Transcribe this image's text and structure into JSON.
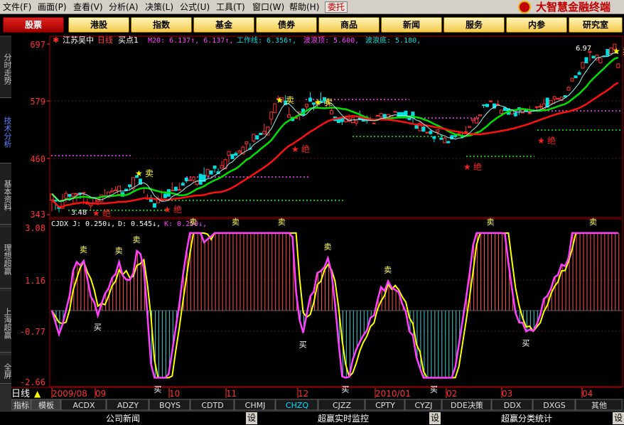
{
  "menu": [
    "文件(F)",
    "画面(P)",
    "查看(V)",
    "分析(A)",
    "决策(L)",
    "公式(U)",
    "工具(T)",
    "窗口(W)",
    "帮助(H)"
  ],
  "weituo": "委托",
  "brand": "大智慧金融终端",
  "nav": [
    "股票",
    "港股",
    "指数",
    "基金",
    "债券",
    "商品",
    "新闻",
    "服务",
    "内参",
    "研究室"
  ],
  "side_tabs": [
    "分时走势",
    "技术分析",
    "基本资料",
    "理想超赢",
    "上海超赢",
    "全屏"
  ],
  "main": {
    "name": "江苏吴中",
    "period": "日线",
    "point": "买点1",
    "ma": "M20: 6.137↑, 6.137↑,",
    "work_label": "工作线: 6.356↑,",
    "wave_top": "波浪顶: 5.600,",
    "wave_bottom": "波浪底: 5.180,",
    "y_ticks": [
      "697",
      "579",
      "460",
      "343"
    ],
    "low_label": "3.48",
    "high_label": "6.97",
    "sell": "卖",
    "jue": "绝"
  },
  "indicator": {
    "name": "CJDX",
    "j": "J: 0.250↓,",
    "d": "D: 0.545↓,",
    "k": "K: 0.250↓,",
    "y_ticks": [
      "3.08",
      "1.16",
      "-0.77",
      "-2.66"
    ],
    "buy": "买",
    "sell": "卖"
  },
  "timeaxis": {
    "label": "日线",
    "ticks": [
      "2009/08",
      "09",
      "10",
      "11",
      "12",
      "2010/01",
      "02",
      "03",
      "04"
    ]
  },
  "tabs": [
    "指标",
    "模板",
    "ACDX",
    "ADZY",
    "BQYS",
    "CDTD",
    "CHMJ",
    "CHZQ",
    "CJZZ",
    "CPTY",
    "CYZJ",
    "DDE决策",
    "DDX",
    "DXGS",
    "其他"
  ],
  "active_tab": "CHZQ",
  "panels": [
    {
      "label": "公司新闻",
      "set": "设"
    },
    {
      "label": "超赢实时监控",
      "set": "设"
    },
    {
      "label": "超赢分类统计",
      "set": "设"
    }
  ],
  "colors": {
    "up": "#ff3030",
    "down": "#00e0e0",
    "green": "#00e000",
    "yellow": "#ffff00",
    "magenta": "#ff40ff",
    "red": "#ff1010",
    "brand": "#c00000"
  },
  "chart_data": {
    "candles": [
      [
        3.73,
        3.86,
        3.5,
        3.79
      ],
      [
        3.73,
        3.71,
        3.53,
        3.49
      ],
      [
        3.6,
        3.56,
        3.48,
        3.41
      ],
      [
        3.56,
        3.73,
        3.65,
        3.86
      ],
      [
        3.77,
        3.87,
        3.68,
        3.92
      ],
      [
        3.85,
        3.81,
        3.72,
        3.7
      ],
      [
        3.81,
        3.87,
        3.67,
        3.75
      ],
      [
        3.87,
        3.87,
        3.7,
        3.82
      ],
      [
        3.88,
        3.86,
        3.76,
        3.74
      ],
      [
        3.88,
        3.89,
        3.64,
        3.73
      ],
      [
        3.65,
        3.69,
        3.69,
        3.76
      ],
      [
        3.61,
        3.66,
        3.51,
        3.57
      ],
      [
        3.66,
        3.78,
        3.79,
        3.71
      ],
      [
        3.7,
        3.73,
        3.62,
        3.62
      ],
      [
        3.71,
        3.84,
        3.86,
        3.82
      ],
      [
        3.8,
        3.82,
        3.84,
        3.96
      ],
      [
        3.79,
        3.9,
        3.98,
        3.87
      ],
      [
        3.9,
        3.92,
        4.01,
        3.99
      ],
      [
        3.94,
        3.94,
        4.02,
        4.02
      ],
      [
        3.85,
        4.02,
        3.81,
        3.94
      ],
      [
        3.89,
        3.81,
        3.92,
        3.88
      ],
      [
        3.96,
        3.93,
        4.0,
        3.95
      ],
      [
        4.05,
        4.01,
        3.95,
        3.91
      ],
      [
        3.97,
        4.2,
        3.88,
        4.06
      ],
      [
        4.24,
        4.2,
        4.21,
        4.06
      ],
      [
        4.17,
        4.06,
        4.22,
        4.11
      ],
      [
        3.99,
        3.99,
        3.87,
        3.9
      ],
      [
        3.75,
        3.77,
        3.75,
        3.86
      ],
      [
        3.78,
        3.7,
        3.71,
        3.84
      ],
      [
        3.66,
        3.58,
        3.63,
        3.56
      ],
      [
        3.67,
        3.75,
        3.78,
        3.82
      ],
      [
        3.72,
        3.74,
        3.83,
        3.94
      ],
      [
        3.86,
        3.78,
        3.86,
        3.8
      ],
      [
        3.95,
        3.81,
        3.88,
        3.83
      ],
      [
        3.92,
        3.94,
        3.96,
        4.1
      ],
      [
        4.0,
        3.93,
        3.92,
        4.01
      ],
      [
        3.94,
        3.95,
        4.01,
        4.09
      ],
      [
        4.08,
        4.04,
        4.09,
        4.11
      ],
      [
        4.19,
        4.13,
        4.09,
        4.01
      ],
      [
        4.14,
        4.15,
        4.14,
        4.21
      ],
      [
        4.14,
        4.21,
        4.11,
        4.09
      ],
      [
        4.06,
        4.12,
        4.02,
        4.11
      ],
      [
        4.27,
        4.06,
        4.32,
        4.24
      ],
      [
        4.25,
        4.12,
        4.27,
        4.41
      ],
      [
        4.23,
        4.37,
        4.29,
        4.26
      ],
      [
        4.34,
        4.27,
        4.27,
        4.29
      ],
      [
        4.44,
        4.39,
        4.3,
        4.32
      ],
      [
        4.32,
        4.28,
        4.43,
        4.39
      ],
      [
        4.39,
        4.45,
        4.49,
        4.55
      ],
      [
        4.38,
        4.57,
        4.53,
        4.59
      ],
      [
        4.66,
        4.74,
        4.51,
        4.6
      ],
      [
        4.68,
        4.59,
        4.66,
        4.58
      ],
      [
        4.7,
        4.66,
        4.69,
        4.74
      ],
      [
        4.71,
        4.75,
        4.71,
        4.78
      ],
      [
        4.69,
        4.83,
        4.85,
        4.86
      ],
      [
        4.9,
        4.94,
        4.76,
        4.73
      ],
      [
        4.8,
        4.79,
        4.81,
        4.91
      ],
      [
        4.96,
        5.1,
        4.93,
        4.91
      ],
      [
        5.07,
        5.0,
        4.98,
        5.0
      ],
      [
        5.12,
        5.09,
        5.12,
        5.08
      ],
      [
        5.1,
        5.16,
        5.27,
        5.32
      ],
      [
        5.08,
        5.25,
        5.23,
        5.16
      ],
      [
        5.41,
        5.56,
        5.29,
        5.25
      ],
      [
        5.55,
        5.73,
        5.64,
        5.58
      ],
      [
        5.84,
        5.84,
        5.94,
        5.9
      ],
      [
        5.79,
        5.86,
        5.75,
        5.65
      ],
      [
        5.79,
        5.71,
        5.88,
        5.91
      ],
      [
        5.45,
        5.5,
        5.51,
        5.66
      ],
      [
        5.45,
        5.38,
        5.37,
        5.31
      ],
      [
        5.43,
        5.44,
        5.47,
        5.5
      ],
      [
        5.49,
        5.56,
        5.39,
        5.46
      ],
      [
        5.62,
        5.5,
        5.54,
        5.64
      ],
      [
        5.67,
        5.72,
        5.58,
        5.52
      ],
      [
        5.85,
        5.78,
        5.9,
        5.97
      ],
      [
        5.75,
        5.72,
        5.59,
        5.7
      ],
      [
        5.74,
        5.78,
        5.64,
        5.6
      ],
      [
        5.79,
        5.76,
        5.88,
        5.97
      ],
      [
        5.86,
        5.79,
        5.72,
        5.79
      ],
      [
        5.65,
        5.78,
        5.67,
        5.6
      ],
      [
        5.52,
        5.59,
        5.56,
        5.66
      ],
      [
        5.46,
        5.38,
        5.39,
        5.3
      ],
      [
        5.44,
        5.34,
        5.35,
        5.44
      ],
      [
        5.44,
        5.36,
        5.29,
        5.25
      ],
      [
        5.36,
        5.43,
        5.34,
        5.48
      ],
      [
        5.37,
        5.41,
        5.35,
        5.51
      ],
      [
        5.34,
        5.44,
        5.48,
        5.44
      ],
      [
        5.33,
        5.38,
        5.27,
        5.29
      ],
      [
        5.46,
        5.4,
        5.52,
        5.59
      ],
      [
        5.45,
        5.37,
        5.42,
        5.41
      ],
      [
        5.45,
        5.38,
        5.32,
        5.49
      ],
      [
        5.38,
        5.41,
        5.41,
        5.47
      ],
      [
        5.33,
        5.33,
        5.36,
        5.31
      ],
      [
        5.49,
        5.49,
        5.52,
        5.43
      ],
      [
        5.46,
        5.53,
        5.43,
        5.49
      ],
      [
        5.51,
        5.41,
        5.47,
        5.53
      ],
      [
        5.45,
        5.51,
        5.43,
        5.45
      ],
      [
        5.46,
        5.49,
        5.43,
        5.45
      ],
      [
        5.56,
        5.57,
        5.56,
        5.51
      ],
      [
        5.55,
        5.45,
        5.52,
        5.43
      ],
      [
        5.55,
        5.44,
        5.45,
        5.4
      ],
      [
        5.58,
        5.46,
        5.41,
        5.33
      ],
      [
        5.48,
        5.4,
        5.41,
        5.35
      ],
      [
        5.56,
        5.44,
        5.3,
        5.4
      ],
      [
        5.28,
        5.22,
        5.34,
        5.14
      ],
      [
        5.17,
        5.33,
        5.31,
        5.37
      ],
      [
        5.25,
        5.16,
        5.29,
        5.29
      ],
      [
        5.14,
        5.14,
        5.11,
        5.07
      ],
      [
        5.16,
        5.11,
        5.09,
        5.21
      ],
      [
        5.05,
        5.01,
        4.93,
        4.89
      ],
      [
        5.14,
        5.19,
        5.08,
        5.17
      ],
      [
        5.02,
        4.99,
        5.04,
        5.09
      ],
      [
        4.92,
        5.02,
        5.02,
        5.05
      ],
      [
        4.95,
        4.92,
        4.91,
        4.94
      ],
      [
        5.07,
        5.0,
        4.99,
        5.09
      ],
      [
        5.07,
        5.05,
        5.02,
        5.03
      ],
      [
        5.09,
        5.11,
        5.05,
        5.14
      ],
      [
        5.06,
        5.04,
        5.06,
        5.16
      ],
      [
        5.15,
        5.15,
        5.19,
        5.27
      ],
      [
        5.24,
        5.26,
        5.29,
        5.26
      ],
      [
        5.38,
        5.41,
        5.32,
        5.25
      ],
      [
        5.33,
        5.42,
        5.46,
        5.48
      ],
      [
        5.48,
        5.5,
        5.47,
        5.36
      ],
      [
        5.71,
        5.7,
        5.64,
        5.67
      ],
      [
        5.72,
        5.67,
        5.8,
        5.7
      ],
      [
        5.79,
        5.79,
        5.76,
        5.68
      ],
      [
        5.73,
        5.64,
        5.69,
        5.65
      ],
      [
        5.71,
        5.72,
        5.78,
        5.8
      ],
      [
        5.53,
        5.6,
        5.5,
        5.57
      ],
      [
        5.65,
        5.59,
        5.61,
        5.49
      ],
      [
        5.63,
        5.51,
        5.56,
        5.5
      ],
      [
        5.52,
        5.61,
        5.52,
        5.49
      ],
      [
        5.54,
        5.48,
        5.46,
        5.59
      ],
      [
        5.65,
        5.6,
        5.5,
        5.59
      ],
      [
        5.54,
        5.6,
        5.53,
        5.57
      ],
      [
        5.61,
        5.57,
        5.56,
        5.52
      ],
      [
        5.54,
        5.54,
        5.64,
        5.68
      ],
      [
        5.6,
        5.59,
        5.65,
        5.62
      ],
      [
        5.67,
        5.67,
        5.59,
        5.66
      ],
      [
        5.68,
        5.68,
        5.62,
        5.74
      ],
      [
        5.62,
        5.73,
        5.82,
        5.84
      ],
      [
        5.85,
        5.66,
        5.85,
        5.69
      ],
      [
        5.73,
        5.8,
        5.77,
        5.69
      ],
      [
        5.83,
        5.88,
        5.72,
        5.8
      ],
      [
        5.83,
        5.84,
        5.88,
        5.86
      ],
      [
        5.8,
        5.87,
        5.9,
        5.74
      ],
      [
        5.9,
        5.87,
        5.87,
        5.88
      ],
      [
        6.01,
        6.07,
        6.04,
        6.1
      ],
      [
        6.2,
        6.26,
        6.32,
        6.24
      ],
      [
        6.31,
        6.27,
        6.29,
        6.25
      ],
      [
        6.38,
        6.34,
        6.56,
        6.42
      ],
      [
        6.47,
        6.59,
        6.46,
        6.59
      ],
      [
        6.69,
        6.58,
        6.57,
        6.51
      ],
      [
        6.8,
        6.82,
        6.61,
        6.75
      ],
      [
        6.72,
        6.68,
        6.73,
        6.58
      ],
      [
        6.64,
        6.74,
        6.63,
        6.64
      ],
      [
        6.58,
        6.68,
        6.67,
        6.51
      ],
      [
        6.72,
        6.71,
        6.72,
        6.71
      ],
      [
        6.86,
        6.73,
        6.75,
        6.85
      ],
      [
        6.77,
        6.89,
        6.8,
        6.72
      ],
      [
        6.86,
        6.97,
        6.99,
        6.92
      ],
      [
        6.48,
        6.56,
        6.47,
        6.5
      ]
    ]
  }
}
